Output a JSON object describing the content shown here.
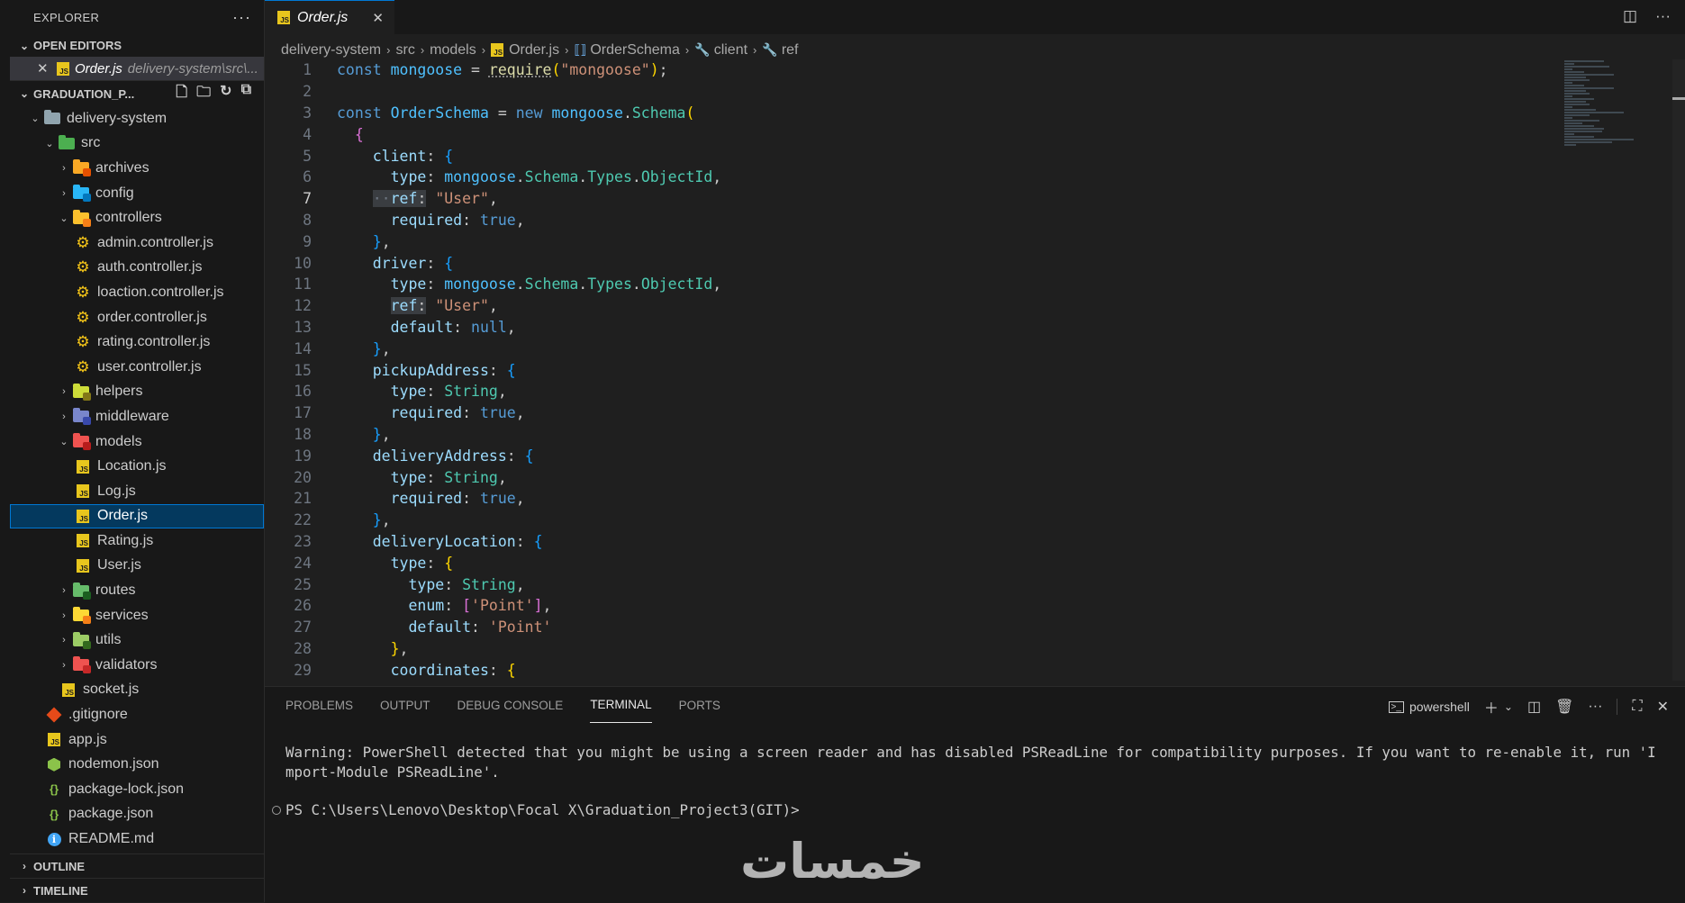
{
  "sidebar": {
    "title": "EXPLORER",
    "more": "···",
    "open_editors_title": "OPEN EDITORS",
    "open_editor": {
      "name": "Order.js",
      "path": "delivery-system\\src\\..."
    },
    "project_title": "GRADUATION_P...",
    "tree": [
      {
        "label": "delivery-system"
      },
      {
        "label": "src"
      },
      {
        "label": "archives"
      },
      {
        "label": "config"
      },
      {
        "label": "controllers"
      },
      {
        "label": "admin.controller.js"
      },
      {
        "label": "auth.controller.js"
      },
      {
        "label": "loaction.controller.js"
      },
      {
        "label": "order.controller.js"
      },
      {
        "label": "rating.controller.js"
      },
      {
        "label": "user.controller.js"
      },
      {
        "label": "helpers"
      },
      {
        "label": "middleware"
      },
      {
        "label": "models"
      },
      {
        "label": "Location.js"
      },
      {
        "label": "Log.js"
      },
      {
        "label": "Order.js"
      },
      {
        "label": "Rating.js"
      },
      {
        "label": "User.js"
      },
      {
        "label": "routes"
      },
      {
        "label": "services"
      },
      {
        "label": "utils"
      },
      {
        "label": "validators"
      },
      {
        "label": "socket.js"
      },
      {
        "label": ".gitignore"
      },
      {
        "label": "app.js"
      },
      {
        "label": "nodemon.json"
      },
      {
        "label": "package-lock.json"
      },
      {
        "label": "package.json"
      },
      {
        "label": "README.md"
      }
    ],
    "outline_title": "OUTLINE",
    "timeline_title": "TIMELINE"
  },
  "editor": {
    "tab": {
      "label": "Order.js",
      "icon": "JS"
    },
    "breadcrumb": [
      "delivery-system",
      "src",
      "models",
      "Order.js",
      "OrderSchema",
      "client",
      "ref"
    ],
    "line_numbers": [
      "1",
      "2",
      "3",
      "4",
      "5",
      "6",
      "7",
      "8",
      "9",
      "10",
      "11",
      "12",
      "13",
      "14",
      "15",
      "16",
      "17",
      "18",
      "19",
      "20",
      "21",
      "22",
      "23",
      "24",
      "25",
      "26",
      "27",
      "28",
      "29"
    ]
  },
  "panel": {
    "tabs": [
      "PROBLEMS",
      "OUTPUT",
      "DEBUG CONSOLE",
      "TERMINAL",
      "PORTS"
    ],
    "shell": "powershell",
    "warning": "Warning: PowerShell detected that you might be using a screen reader and has disabled PSReadLine for compatibility purposes. If you want to re-enable it, run 'Import-Module PSReadLine'.",
    "prompt": "PS C:\\Users\\Lenovo\\Desktop\\Focal X\\Graduation_Project3(GIT)>"
  },
  "watermark": "خمسات",
  "colors": {
    "accent": "#0078d4",
    "selection": "#04395e",
    "js_icon": "#e8c61d"
  }
}
